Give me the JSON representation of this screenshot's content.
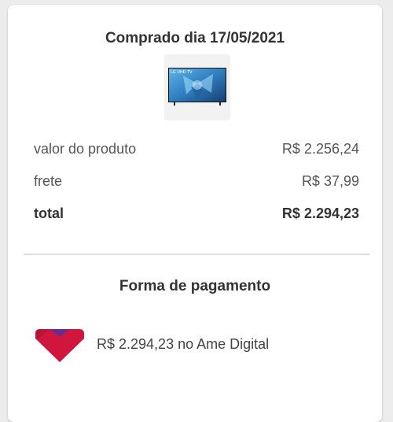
{
  "purchase": {
    "title": "Comprado dia 17/05/2021",
    "product_image": "lg-uhd-tv-thumbnail",
    "product_brand_text": "LG UHD TV"
  },
  "summary": {
    "rows": [
      {
        "label": "valor do produto",
        "value": "R$ 2.256,24"
      },
      {
        "label": "frete",
        "value": "R$ 37,99"
      },
      {
        "label": "total",
        "value": "R$ 2.294,23"
      }
    ]
  },
  "payment": {
    "title": "Forma de pagamento",
    "method_icon": "ame-digital-logo-icon",
    "method_text": "R$ 2.294,23 no Ame Digital"
  },
  "colors": {
    "card_background": "#ffffff",
    "page_background": "#ececec",
    "ame_red": "#d1163d",
    "ame_purple": "#6b2a8f",
    "tv_screen_blue": "#3f9bd6"
  }
}
